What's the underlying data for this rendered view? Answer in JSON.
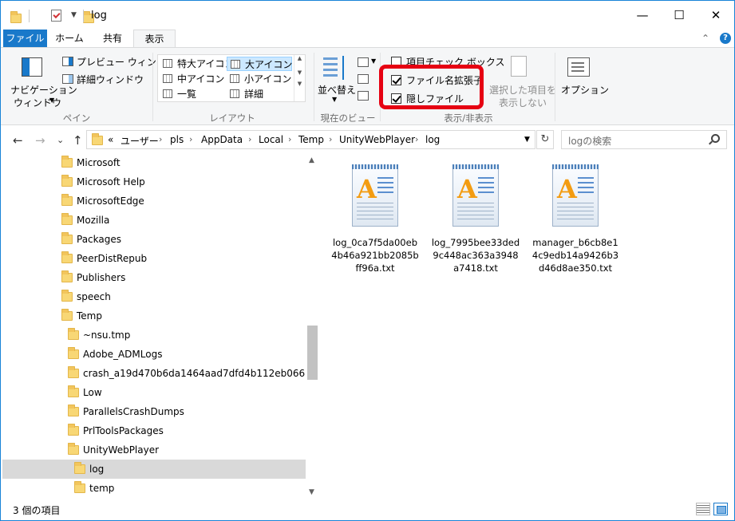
{
  "window": {
    "title": "log",
    "controls": {
      "minimize": "—",
      "maximize": "☐",
      "close": "✕"
    }
  },
  "ribbon_tabs": {
    "file": "ファイル",
    "home": "ホーム",
    "share": "共有",
    "view": "表示",
    "collapse": "⌃",
    "help": "?"
  },
  "ribbon": {
    "pane": {
      "nav_pane_line1": "ナビゲーション",
      "nav_pane_line2": "ウィンドウ",
      "preview": "プレビュー ウィンドウ",
      "details": "詳細ウィンドウ",
      "label": "ペイン"
    },
    "layout": {
      "items": [
        "特大アイコン",
        "大アイコン",
        "中アイコン",
        "小アイコン",
        "一覧",
        "詳細"
      ],
      "selected": "大アイコン",
      "label": "レイアウト"
    },
    "current_view": {
      "sort": "並べ替え",
      "label": "現在のビュー"
    },
    "show_hide": {
      "item_checkbox": "項目チェック ボックス",
      "file_extensions": "ファイル名拡張子",
      "hidden_items": "隠しファイル",
      "hide_selected_line1": "選択した項目を",
      "hide_selected_line2": "表示しない",
      "label": "表示/非表示",
      "item_checkbox_checked": false,
      "file_extensions_checked": true,
      "hidden_items_checked": true
    },
    "options": {
      "label": "オプション"
    }
  },
  "nav": {
    "back": "←",
    "forward": "→",
    "recent": "⌄",
    "up": "↑",
    "overflow": "«",
    "breadcrumb": [
      "ユーザー",
      "pls",
      "AppData",
      "Local",
      "Temp",
      "UnityWebPlayer",
      "log"
    ],
    "refresh": "↻",
    "search_placeholder": "logの検索"
  },
  "tree": [
    {
      "label": "Microsoft",
      "level": 0
    },
    {
      "label": "Microsoft Help",
      "level": 0
    },
    {
      "label": "MicrosoftEdge",
      "level": 0
    },
    {
      "label": "Mozilla",
      "level": 0
    },
    {
      "label": "Packages",
      "level": 0
    },
    {
      "label": "PeerDistRepub",
      "level": 0
    },
    {
      "label": "Publishers",
      "level": 0
    },
    {
      "label": "speech",
      "level": 0
    },
    {
      "label": "Temp",
      "level": 0
    },
    {
      "label": "~nsu.tmp",
      "level": 1
    },
    {
      "label": "Adobe_ADMLogs",
      "level": 1
    },
    {
      "label": "crash_a19d470b6da1464aad7dfd4b112eb066",
      "level": 1
    },
    {
      "label": "Low",
      "level": 1
    },
    {
      "label": "ParallelsCrashDumps",
      "level": 1
    },
    {
      "label": "PrlToolsPackages",
      "level": 1
    },
    {
      "label": "UnityWebPlayer",
      "level": 1
    },
    {
      "label": "log",
      "level": 2,
      "selected": true
    },
    {
      "label": "temp",
      "level": 2
    }
  ],
  "files": [
    {
      "name": "log_0ca7f5da00eb4b46a921bb2085bff96a.txt"
    },
    {
      "name": "log_7995bee33ded9c448ac363a3948a7418.txt"
    },
    {
      "name": "manager_b6cb8e14c9edb14a9426b3d46d8ae350.txt"
    }
  ],
  "status": {
    "item_count": "3 個の項目"
  }
}
